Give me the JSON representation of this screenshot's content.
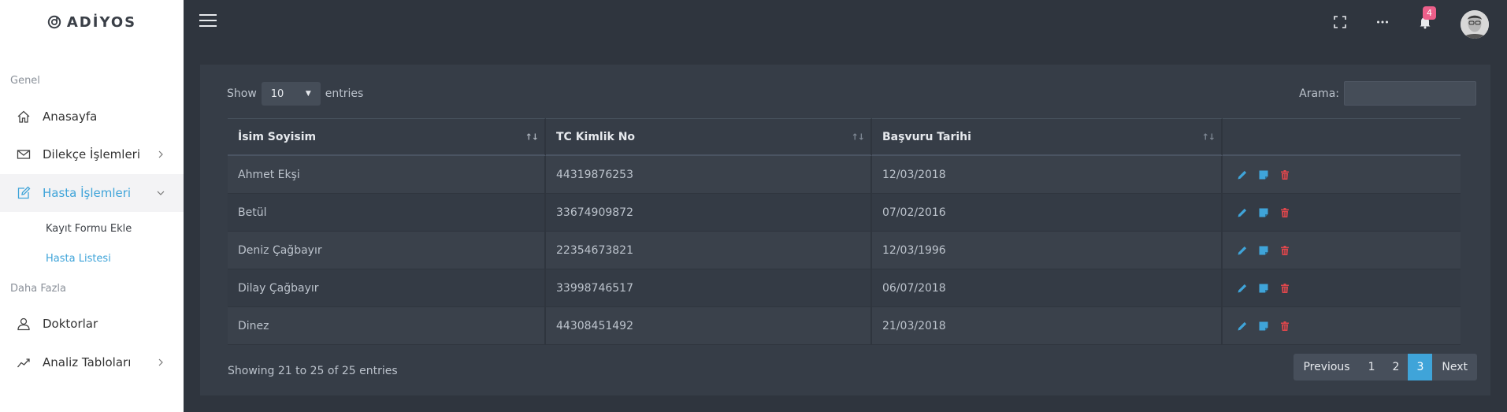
{
  "brand": {
    "name": "ADİYOS"
  },
  "sidebar": {
    "sections": [
      {
        "label": "Genel"
      },
      {
        "label": "Daha Fazla"
      }
    ],
    "items": [
      {
        "label": "Anasayfa",
        "icon": "home-icon"
      },
      {
        "label": "Dilekçe İşlemleri",
        "icon": "envelope-icon"
      },
      {
        "label": "Hasta İşlemleri",
        "icon": "edit-icon"
      },
      {
        "label": "Doktorlar",
        "icon": "user-icon"
      },
      {
        "label": "Analiz Tabloları",
        "icon": "chart-line-icon"
      }
    ],
    "subitems": [
      {
        "label": "Kayıt Formu Ekle"
      },
      {
        "label": "Hasta Listesi"
      }
    ]
  },
  "topbar": {
    "notification_count": "4"
  },
  "table_controls": {
    "show_label": "Show",
    "entries_value": "10",
    "entries_label": "entries",
    "search_label": "Arama:",
    "search_value": ""
  },
  "table": {
    "columns": [
      "İsim Soyisim",
      "TC Kimlik No",
      "Başvuru Tarihi",
      ""
    ],
    "rows": [
      {
        "name": "Ahmet Ekşi",
        "tc": "44319876253",
        "date": "12/03/2018"
      },
      {
        "name": "Betül",
        "tc": "33674909872",
        "date": "07/02/2016"
      },
      {
        "name": "Deniz Çağbayır",
        "tc": "22354673821",
        "date": "12/03/1996"
      },
      {
        "name": "Dilay Çağbayır",
        "tc": "33998746517",
        "date": "06/07/2018"
      },
      {
        "name": "Dinez",
        "tc": "44308451492",
        "date": "21/03/2018"
      }
    ]
  },
  "footer": {
    "info": "Showing 21 to 25 of 25 entries",
    "pagination": {
      "previous": "Previous",
      "pages": [
        "1",
        "2",
        "3"
      ],
      "current": "3",
      "next": "Next"
    }
  },
  "colors": {
    "accent": "#3fa4d9",
    "danger": "#e0474c",
    "badge": "#ec5f8a"
  }
}
